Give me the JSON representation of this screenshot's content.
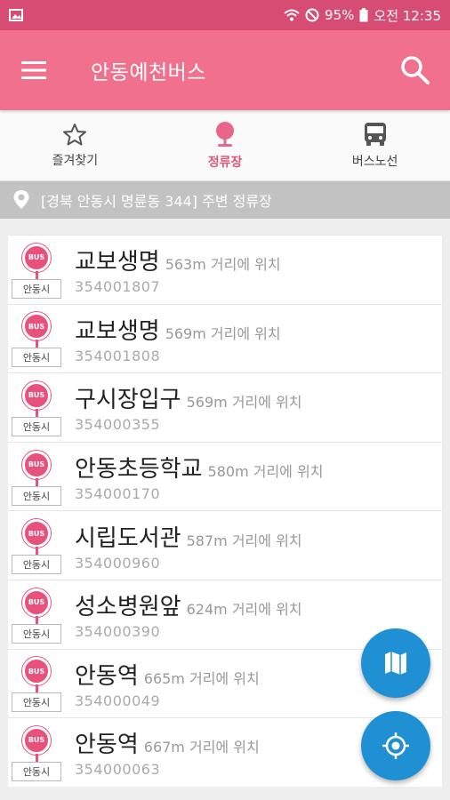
{
  "status": {
    "battery": "95%",
    "time": "오전 12:35"
  },
  "appbar": {
    "title": "안동예천버스"
  },
  "tabs": [
    {
      "label": "즐겨찾기"
    },
    {
      "label": "정류장"
    },
    {
      "label": "버스노선"
    }
  ],
  "location": {
    "text": "[경북 안동시 명륜동 344] 주변 정류장"
  },
  "badge": {
    "bus": "BUS",
    "city": "안동시"
  },
  "stops": [
    {
      "name": "교보생명",
      "dist": "563m 거리에 위치",
      "code": "354001807"
    },
    {
      "name": "교보생명",
      "dist": "569m 거리에 위치",
      "code": "354001808"
    },
    {
      "name": "구시장입구",
      "dist": "569m 거리에 위치",
      "code": "354000355"
    },
    {
      "name": "안동초등학교",
      "dist": "580m 거리에 위치",
      "code": "354000170"
    },
    {
      "name": "시립도서관",
      "dist": "587m 거리에 위치",
      "code": "354000960"
    },
    {
      "name": "성소병원앞",
      "dist": "624m 거리에 위치",
      "code": "354000390"
    },
    {
      "name": "안동역",
      "dist": "665m 거리에 위치",
      "code": "354000049"
    },
    {
      "name": "안동역",
      "dist": "667m 거리에 위치",
      "code": "354000063"
    }
  ],
  "colors": {
    "appbar": "#f0708e",
    "statusbar": "#d64c72",
    "accent": "#e0577c",
    "fab": "#1e90d3"
  },
  "icons": {
    "menu": "menu-icon",
    "search": "search-icon",
    "star": "star-icon",
    "stop": "stop-pin-icon",
    "bus": "bus-icon",
    "map": "map-icon",
    "locate": "my-location-icon"
  }
}
